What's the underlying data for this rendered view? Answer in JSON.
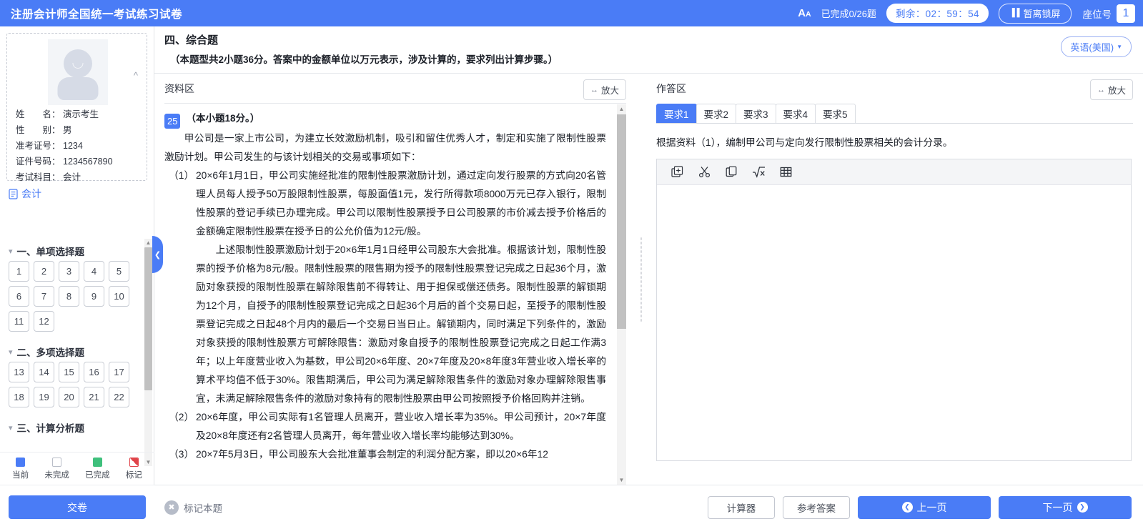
{
  "topbar": {
    "title": "注册会计师全国统一考试练习试卷",
    "font_icon": "font-size-icon",
    "font_icon_big": "A",
    "font_icon_small": "A",
    "progress": "已完成0/26题",
    "timer": "剩余：02：59：54",
    "lock_label": "暂离锁屏",
    "seat_label": "座位号",
    "seat_number": "1",
    "accent": "#4a7cf6"
  },
  "sidebar": {
    "avatar_alt": "考生照片",
    "info": [
      {
        "label": "姓　　名：",
        "value": "演示考生"
      },
      {
        "label": "性　　别：",
        "value": "男"
      },
      {
        "label": "准考证号：",
        "value": "1234"
      },
      {
        "label": "证件号码：",
        "value": "1234567890"
      },
      {
        "label": "考试科目：",
        "value": "会计"
      }
    ],
    "subject": "会计",
    "sections": [
      {
        "title": "一、单项选择题",
        "questions": [
          "1",
          "2",
          "3",
          "4",
          "5",
          "6",
          "7",
          "8",
          "9",
          "10",
          "11",
          "12"
        ]
      },
      {
        "title": "二、多项选择题",
        "questions": [
          "13",
          "14",
          "15",
          "16",
          "17",
          "18",
          "19",
          "20",
          "21",
          "22"
        ]
      },
      {
        "title": "三、计算分析题",
        "questions": []
      }
    ],
    "legend": [
      {
        "label": "当前",
        "state": "cur",
        "color": "#4a7cf6"
      },
      {
        "label": "未完成",
        "state": "undone",
        "color": "#ffffff"
      },
      {
        "label": "已完成",
        "state": "done",
        "color": "#3fc07c"
      },
      {
        "label": "标记",
        "state": "flag",
        "color": "#e0444a"
      }
    ],
    "submit_label": "交卷"
  },
  "exam": {
    "section_title": "四、综合题",
    "section_note": "（本题型共2小题36分。答案中的金额单位以万元表示，涉及计算的，要求列出计算步骤。）",
    "language": "英语(美国)"
  },
  "material": {
    "pane_title": "资料区",
    "zoom_label": "放大",
    "question_number": "25",
    "question_points": "（本小题18分。）",
    "paragraphs": [
      "甲公司是一家上市公司，为建立长效激励机制，吸引和留住优秀人才，制定和实施了限制性股票激励计划。甲公司发生的与该计划相关的交易或事项如下："
    ],
    "items": [
      {
        "marker": "（1）",
        "texts": [
          "20×6年1月1日，甲公司实施经批准的限制性股票激励计划，通过定向发行股票的方式向20名管理人员每人授予50万股限制性股票，每股面值1元，发行所得款项8000万元已存入银行，限制性股票的登记手续已办理完成。甲公司以限制性股票授予日公司股票的市价减去授予价格后的金额确定限制性股票在授予日的公允价值为12元/股。",
          "上述限制性股票激励计划于20×6年1月1日经甲公司股东大会批准。根据该计划，限制性股票的授予价格为8元/股。限制性股票的限售期为授予的限制性股票登记完成之日起36个月，激励对象获授的限制性股票在解除限售前不得转让、用于担保或偿还债务。限制性股票的解锁期为12个月，自授予的限制性股票登记完成之日起36个月后的首个交易日起，至授予的限制性股票登记完成之日起48个月内的最后一个交易日当日止。解锁期内，同时满足下列条件的，激励对象获授的限制性股票方可解除限售：激励对象自授予的限制性股票登记完成之日起工作满3年；以上年度营业收入为基数，甲公司20×6年度、20×7年度及20×8年度3年营业收入增长率的算术平均值不低于30%。限售期满后，甲公司为满足解除限售条件的激励对象办理解除限售事宜，未满足解除限售条件的激励对象持有的限制性股票由甲公司按照授予价格回购并注销。"
        ]
      },
      {
        "marker": "（2）",
        "texts": [
          "20×6年度，甲公司实际有1名管理人员离开，营业收入增长率为35%。甲公司预计，20×7年度及20×8年度还有2名管理人员离开，每年营业收入增长率均能够达到30%。"
        ]
      },
      {
        "marker": "（3）",
        "texts": [
          "20×7年5月3日，甲公司股东大会批准董事会制定的利润分配方案，即以20×6年12"
        ]
      }
    ]
  },
  "answer": {
    "pane_title": "作答区",
    "zoom_label": "放大",
    "tabs": [
      {
        "label": "要求1",
        "active": true
      },
      {
        "label": "要求2",
        "active": false
      },
      {
        "label": "要求3",
        "active": false
      },
      {
        "label": "要求4",
        "active": false
      },
      {
        "label": "要求5",
        "active": false
      }
    ],
    "requirement_text": "根据资料（1），编制甲公司与定向发行限制性股票相关的会计分录。",
    "toolbar_icons": [
      "insert-icon",
      "cut-scissors-icon",
      "copy-icon",
      "formula-sqrt-icon",
      "table-icon"
    ],
    "editor_value": ""
  },
  "bottombar": {
    "flag_label": "标记本题",
    "calculator_label": "计算器",
    "reference_label": "参考答案",
    "prev_label": "上一页",
    "next_label": "下一页"
  }
}
